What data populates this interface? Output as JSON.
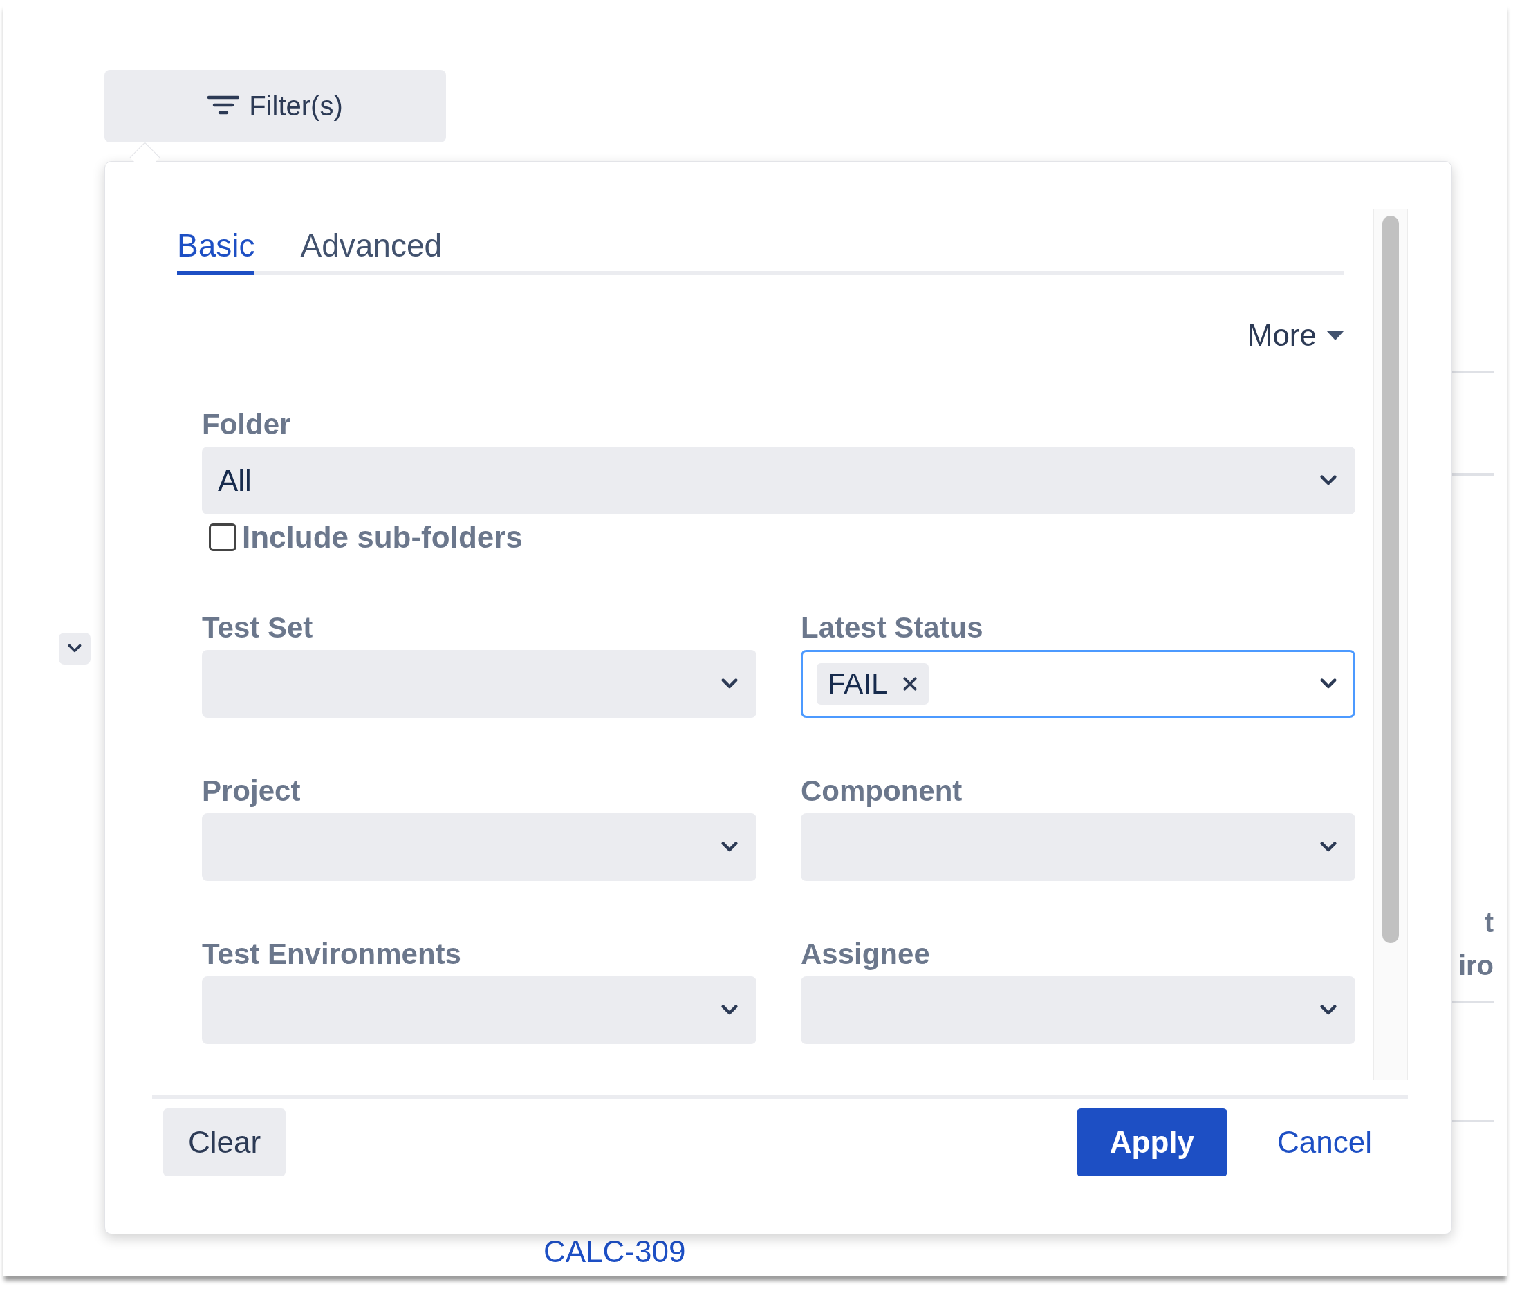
{
  "filter_button": {
    "label": "Filter(s)"
  },
  "tabs": [
    {
      "label": "Basic",
      "selected": true
    },
    {
      "label": "Advanced",
      "selected": false
    }
  ],
  "more_menu": {
    "label": "More"
  },
  "folder": {
    "label": "Folder",
    "value": "All"
  },
  "include_subfolders": {
    "label": "Include sub-folders",
    "checked": false
  },
  "fields": [
    {
      "label": "Test Set",
      "focused": false
    },
    {
      "label": "Latest Status",
      "focused": true,
      "tags": [
        "FAIL"
      ]
    },
    {
      "label": "Project",
      "focused": false
    },
    {
      "label": "Component",
      "focused": false
    },
    {
      "label": "Test Environments",
      "focused": false
    },
    {
      "label": "Assignee",
      "focused": false
    }
  ],
  "buttons": [
    {
      "kind": "secondary",
      "label": "Clear"
    },
    {
      "kind": "primary",
      "label": "Apply"
    },
    {
      "kind": "link",
      "label": "Cancel"
    }
  ],
  "background": {
    "link": "CALC-309",
    "fragments": [
      "t",
      "iro"
    ]
  }
}
